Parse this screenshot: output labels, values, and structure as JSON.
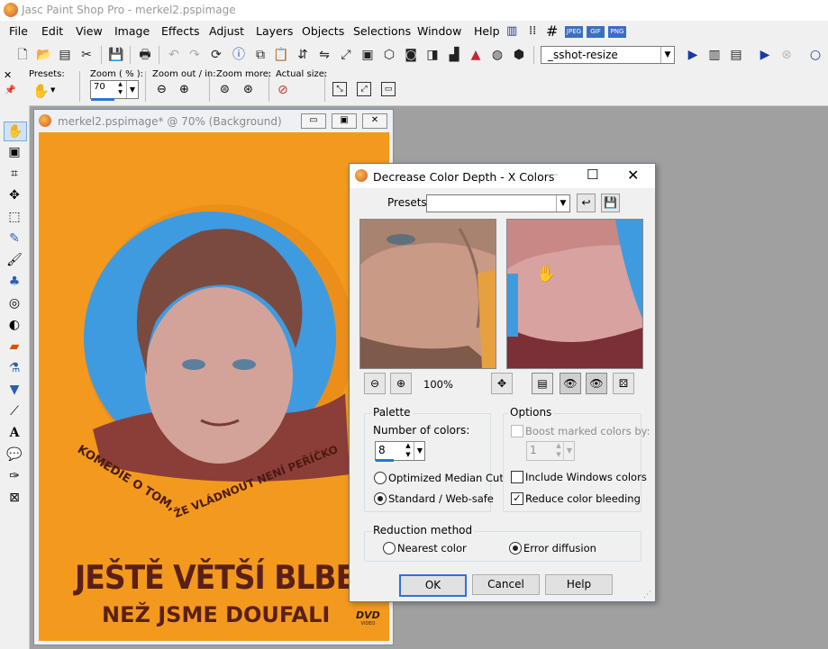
{
  "app": {
    "title": "Jasc Paint Shop Pro - merkel2.pspimage"
  },
  "menu": [
    "File",
    "Edit",
    "View",
    "Image",
    "Effects",
    "Adjust",
    "Layers",
    "Objects",
    "Selections",
    "Window",
    "Help"
  ],
  "toolbar1": {
    "script_select": "_sshot-resize",
    "format_icons": [
      "JPEG",
      "GIF",
      "PNG"
    ]
  },
  "toolbar2": {
    "presets_label": "Presets:",
    "zoom_label": "Zoom ( % ):",
    "zoom_value": "70",
    "zoom_out_in_label": "Zoom out / in:",
    "zoom_more_label": "Zoom more:",
    "actual_size_label": "Actual size:"
  },
  "doc": {
    "title": "merkel2.pspimage* @  70% (Background)"
  },
  "poster": {
    "tagline_1": "KOMEDIE O TOM,",
    "tagline_2": "ŽE VLÁDNOUT NENÍ PEŘÍČKO",
    "headline_1": "JEŠTĚ VĚTŠÍ BLBEC",
    "headline_2": "NEŽ JSME DOUFALI",
    "dvd": "DVD",
    "dvd_sub": "VIDEO"
  },
  "dialog": {
    "title": "Decrease Color Depth - X Colors",
    "presets_label": "Presets:",
    "presets_value": "",
    "zoom_pct": "100%",
    "palette_label": "Palette",
    "num_colors_label": "Number of colors:",
    "num_colors_value": "8",
    "opt_median": "Optimized Median Cut",
    "opt_standard": "Standard / Web-safe",
    "options_label": "Options",
    "boost_label": "Boost marked colors by:",
    "boost_value": "1",
    "include_windows": "Include Windows colors",
    "reduce_bleeding": "Reduce color bleeding",
    "reduction_label": "Reduction method",
    "nearest": "Nearest color",
    "error_diffusion": "Error diffusion",
    "ok": "OK",
    "cancel": "Cancel",
    "help": "Help"
  },
  "colors": {
    "poster_orange": "#f39a1e",
    "sky": "#3e9be0",
    "skin": "#d3a39a",
    "hair": "#7b4a3e"
  }
}
